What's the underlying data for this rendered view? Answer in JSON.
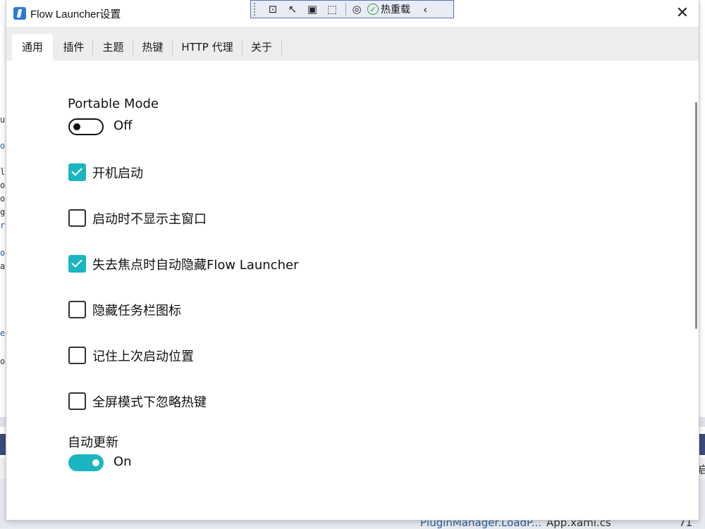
{
  "window": {
    "title": "Flow Launcher设置",
    "close_glyph": "✕"
  },
  "debug_toolbar": {
    "hot_reload_label": "热重载",
    "icons": [
      "select-element-icon",
      "pointer-icon",
      "frame-icon",
      "track-focus-icon",
      "display-layout-icon"
    ],
    "chevron": "‹"
  },
  "tabs": [
    {
      "label": "通用",
      "active": true
    },
    {
      "label": "插件",
      "active": false
    },
    {
      "label": "主题",
      "active": false
    },
    {
      "label": "热键",
      "active": false
    },
    {
      "label": "HTTP 代理",
      "active": false
    },
    {
      "label": "关于",
      "active": false
    }
  ],
  "settings": {
    "portable_mode": {
      "title": "Portable Mode",
      "state_label": "Off",
      "on": false
    },
    "checkboxes": [
      {
        "label": "开机启动",
        "checked": true
      },
      {
        "label": "启动时不显示主窗口",
        "checked": false
      },
      {
        "label": "失去焦点时自动隐藏Flow Launcher",
        "checked": true
      },
      {
        "label": "隐藏任务栏图标",
        "checked": false
      },
      {
        "label": "记住上次启动位置",
        "checked": false
      },
      {
        "label": "全屏模式下忽略热键",
        "checked": false
      }
    ],
    "auto_update": {
      "title": "自动更新",
      "state_label": "On",
      "on": true
    }
  },
  "colors": {
    "accent": "#1ab5c1",
    "tabbar_bg": "#ededed"
  },
  "background": {
    "code_fragments": [
      "u",
      "or",
      "le",
      "or",
      "ol",
      "g",
      "r",
      "or",
      "aF",
      "eD",
      "or"
    ],
    "bottom_text_1": "PluginManager.LoadP...",
    "bottom_text_2": "App.xaml.cs",
    "bottom_text_3": "71",
    "right_char": "启"
  }
}
